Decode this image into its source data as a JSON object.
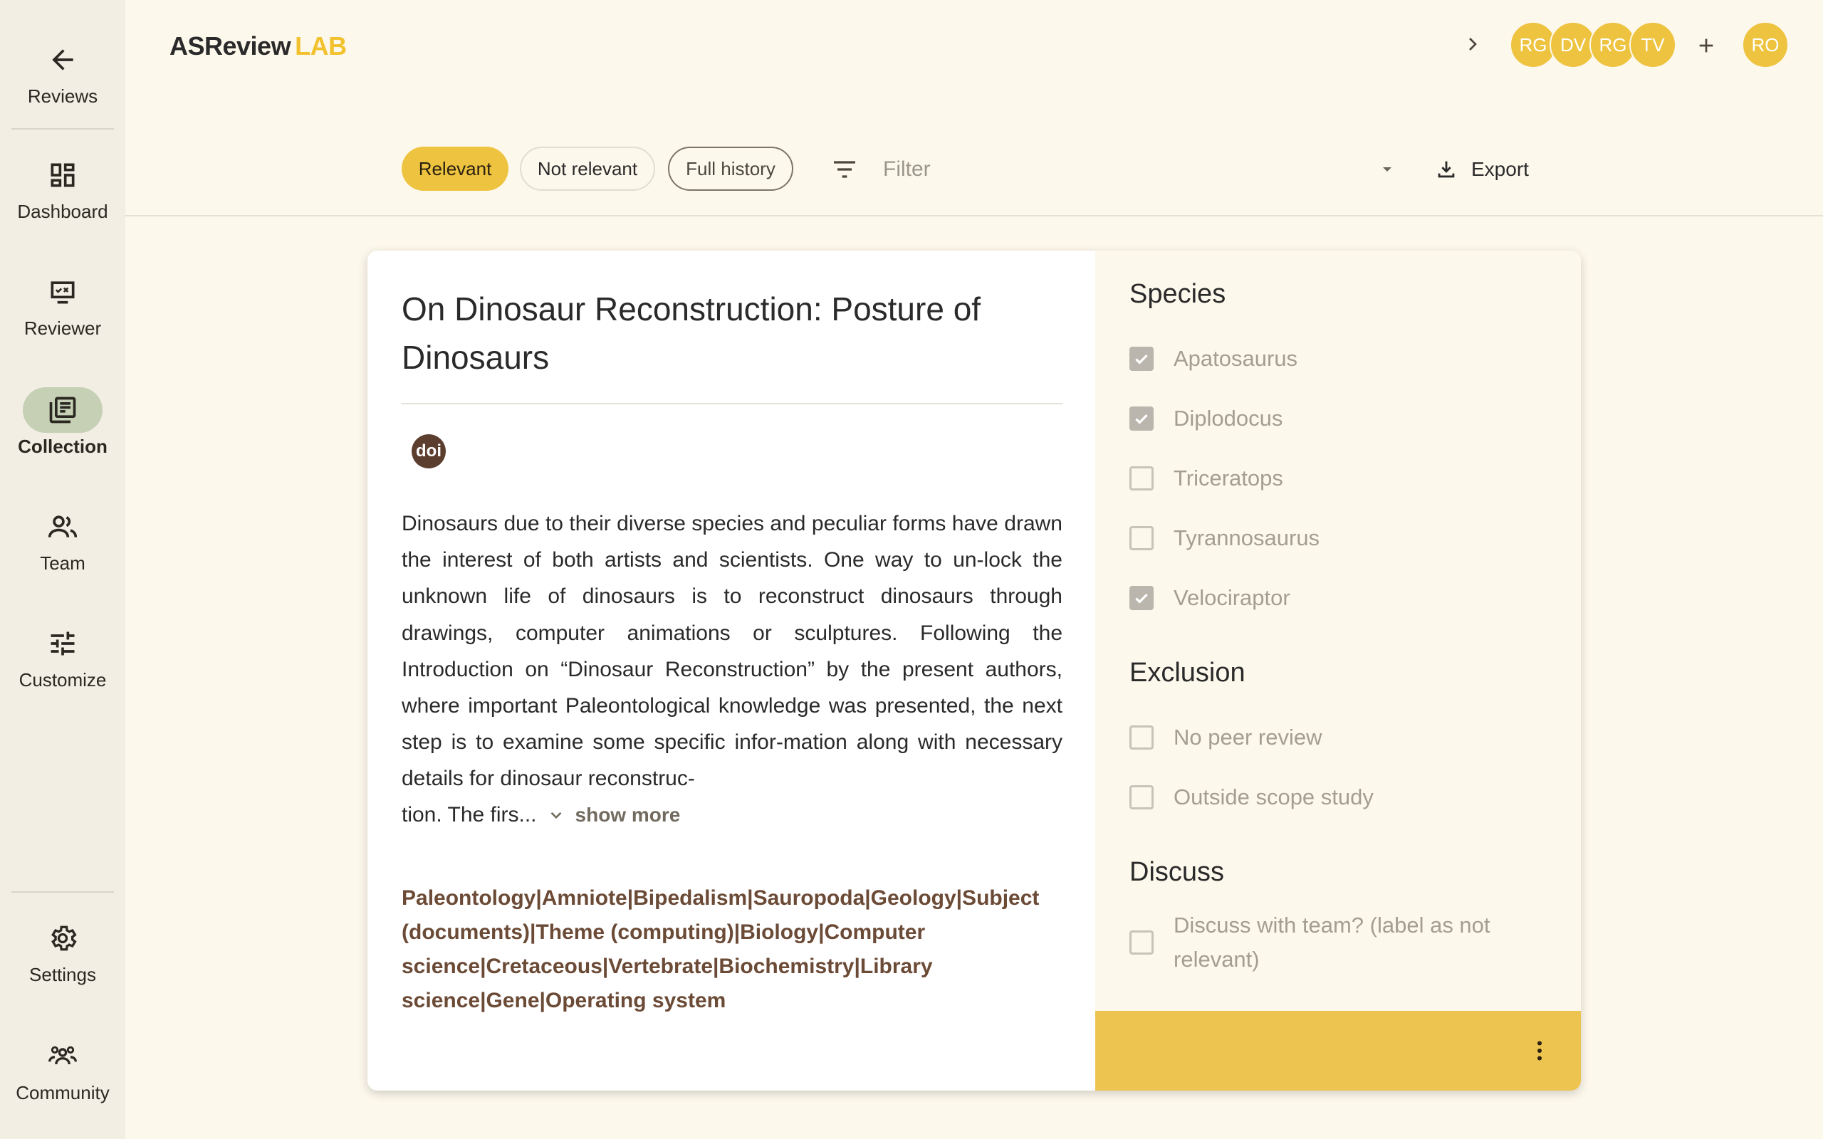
{
  "sidebar": {
    "items": [
      {
        "label": "Reviews",
        "icon": "arrow-left-icon"
      },
      {
        "label": "Dashboard",
        "icon": "dashboard-icon"
      },
      {
        "label": "Reviewer",
        "icon": "monitor-check-icon"
      },
      {
        "label": "Collection",
        "icon": "library-books-icon",
        "active": true
      },
      {
        "label": "Team",
        "icon": "team-icon"
      },
      {
        "label": "Customize",
        "icon": "tune-icon"
      },
      {
        "label": "Settings",
        "icon": "gear-icon"
      },
      {
        "label": "Community",
        "icon": "community-icon"
      }
    ]
  },
  "header": {
    "logo_main": "ASReview",
    "logo_accent": "LAB",
    "avatars": [
      "RG",
      "DV",
      "RG",
      "TV"
    ],
    "user_avatar": "RO"
  },
  "toolbar": {
    "chips": [
      "Relevant",
      "Not relevant",
      "Full history"
    ],
    "active_chip": "Relevant",
    "filter_placeholder": "Filter",
    "export_label": "Export"
  },
  "record": {
    "title": "On Dinosaur Reconstruction: Posture of Dinosaurs",
    "doi_label": "doi",
    "abstract": "Dinosaurs due to their diverse species and peculiar forms have drawn the interest of both artists and scientists. One way to un-lock the unknown life of dinosaurs is to reconstruct dinosaurs through drawings, computer animations or sculptures. Following the Introduction on “Dinosaur Reconstruction” by the present authors, where important Paleontological knowledge was presented, the next step is to examine some specific infor-mation along with necessary details for dinosaur reconstruc-",
    "abstract_tail": "tion. The firs...",
    "show_more": "show more",
    "keywords": "Paleontology|Amniote|Bipedalism|Sauropoda|Geology|Subject (documents)|Theme (computing)|Biology|Computer science|Cretaceous|Vertebrate|Biochemistry|Library science|Gene|Operating system"
  },
  "labels": {
    "species_title": "Species",
    "species": [
      {
        "label": "Apatosaurus",
        "checked": true
      },
      {
        "label": "Diplodocus",
        "checked": true
      },
      {
        "label": "Triceratops",
        "checked": false
      },
      {
        "label": "Tyrannosaurus",
        "checked": false
      },
      {
        "label": "Velociraptor",
        "checked": true
      }
    ],
    "exclusion_title": "Exclusion",
    "exclusion": [
      {
        "label": "No peer review",
        "checked": false
      },
      {
        "label": "Outside scope study",
        "checked": false
      }
    ],
    "discuss_title": "Discuss",
    "discuss": [
      {
        "label": "Discuss with team? (label as not relevant)",
        "checked": false
      }
    ]
  },
  "colors": {
    "accent": "#EEC33F",
    "keyword": "#6B4A36",
    "active_nav": "#C5D0B4"
  }
}
